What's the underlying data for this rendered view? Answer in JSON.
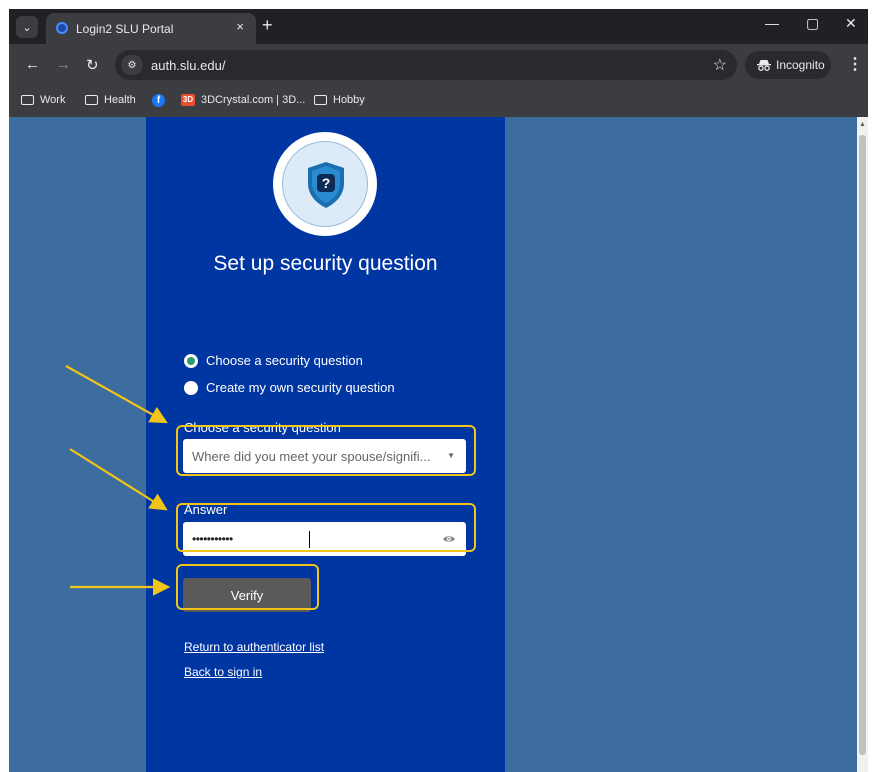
{
  "browser": {
    "tab_title": "Login2 SLU Portal",
    "tab_close": "×",
    "new_tab": "+",
    "tab_search": "⌄",
    "url": "auth.slu.edu/",
    "incognito_label": "Incognito",
    "menu": "⋮",
    "window_controls": {
      "minimize": "—",
      "maximize": "▢",
      "close": "✕"
    },
    "nav": {
      "back": "←",
      "forward": "→",
      "reload": "↻"
    }
  },
  "bookmarks": [
    {
      "label": "Work"
    },
    {
      "label": "Health"
    },
    {
      "label": ""
    },
    {
      "label": "3DCrystal.com | 3D..."
    },
    {
      "label": "Hobby"
    }
  ],
  "page": {
    "title": "Set up security question",
    "radio_options": [
      {
        "label": "Choose a security question",
        "selected": true
      },
      {
        "label": "Create my own security question",
        "selected": false
      }
    ],
    "question_label": "Choose a security question",
    "question_value": "Where did you meet your spouse/signifi...",
    "answer_label": "Answer",
    "answer_value": "•••••••••••",
    "verify_label": "Verify",
    "links": {
      "return": "Return to authenticator list",
      "back": "Back to sign in"
    }
  },
  "colors": {
    "page_bg": "#3c6d9e",
    "card_bg": "#0036a1",
    "highlight": "#f0c419",
    "radio_selected": "#2e9c6f",
    "verify_bg": "#5a5a5a"
  },
  "icons": [
    "shield-question-icon",
    "eye-icon",
    "star-icon",
    "incognito-icon",
    "folder-icon",
    "facebook-icon",
    "3dcrystal-icon"
  ]
}
